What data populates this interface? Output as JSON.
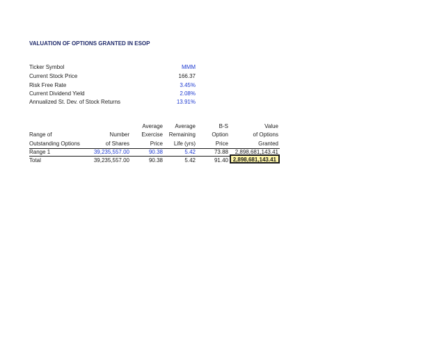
{
  "title": "VALUATION OF OPTIONS GRANTED IN ESOP",
  "inputs": [
    {
      "label": "Ticker Symbol",
      "value": "MMM"
    },
    {
      "label": "Current Stock Price",
      "value": "166.37"
    },
    {
      "label": "Risk Free Rate",
      "value": "3.45%"
    },
    {
      "label": "Current Dividend Yield",
      "value": "2.08%"
    },
    {
      "label": "Annualized St. Dev. of Stock Returns",
      "value": "13.91%"
    }
  ],
  "table": {
    "headers": {
      "range": [
        "",
        "Range of",
        "Outstanding Options"
      ],
      "shares": [
        "",
        "Number",
        "of Shares"
      ],
      "exercise": [
        "Average",
        "Exercise",
        "Price"
      ],
      "life": [
        "Average",
        "Remaining",
        "Life (yrs)"
      ],
      "bs": [
        "B-S",
        "Option",
        "Price"
      ],
      "value": [
        "Value",
        "of Options",
        "Granted"
      ]
    },
    "rows": [
      {
        "range": "Range 1",
        "shares": "39,235,557.00",
        "exercise": "90.38",
        "life": "5.42",
        "bs": "73.88",
        "value": "2,898,681,143.41"
      },
      {
        "range": "Total",
        "shares": "39,235,557.00",
        "exercise": "90.38",
        "life": "5.42",
        "bs": "91.40",
        "value": "2,898,681,143.41"
      }
    ]
  }
}
